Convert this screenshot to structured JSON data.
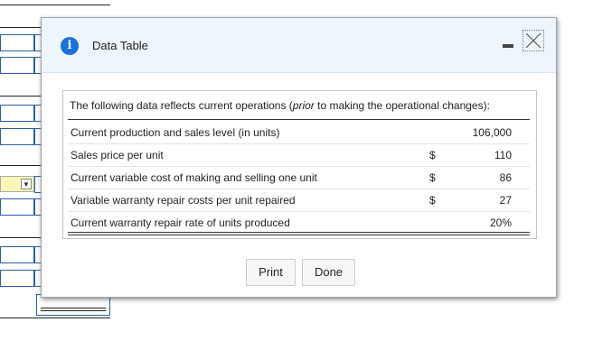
{
  "dialog": {
    "title": "Data Table",
    "intro_pre": "The following data reflects current operations (",
    "intro_italic": "prior",
    "intro_post": " to making the operational changes):",
    "rows": [
      {
        "label": "Current production and sales level (in units)",
        "currency": "",
        "value": "106,000"
      },
      {
        "label": "Sales price per unit",
        "currency": "$",
        "value": "110"
      },
      {
        "label": "Current variable cost of making and selling one unit",
        "currency": "$",
        "value": "86"
      },
      {
        "label": "Variable warranty repair costs per unit repaired",
        "currency": "$",
        "value": "27"
      },
      {
        "label": "Current warranty repair rate of units produced",
        "currency": "",
        "value": "20%"
      }
    ],
    "buttons": {
      "print": "Print",
      "done": "Done"
    },
    "icons": {
      "info": "info-icon",
      "minimize": "minimize-icon",
      "close": "close-icon"
    },
    "colors": {
      "titlebar": "#eef5fb",
      "info_icon": "#1a73d6",
      "input_border": "#2a5ea8",
      "dropdown_fill": "#fbf6b8"
    }
  }
}
